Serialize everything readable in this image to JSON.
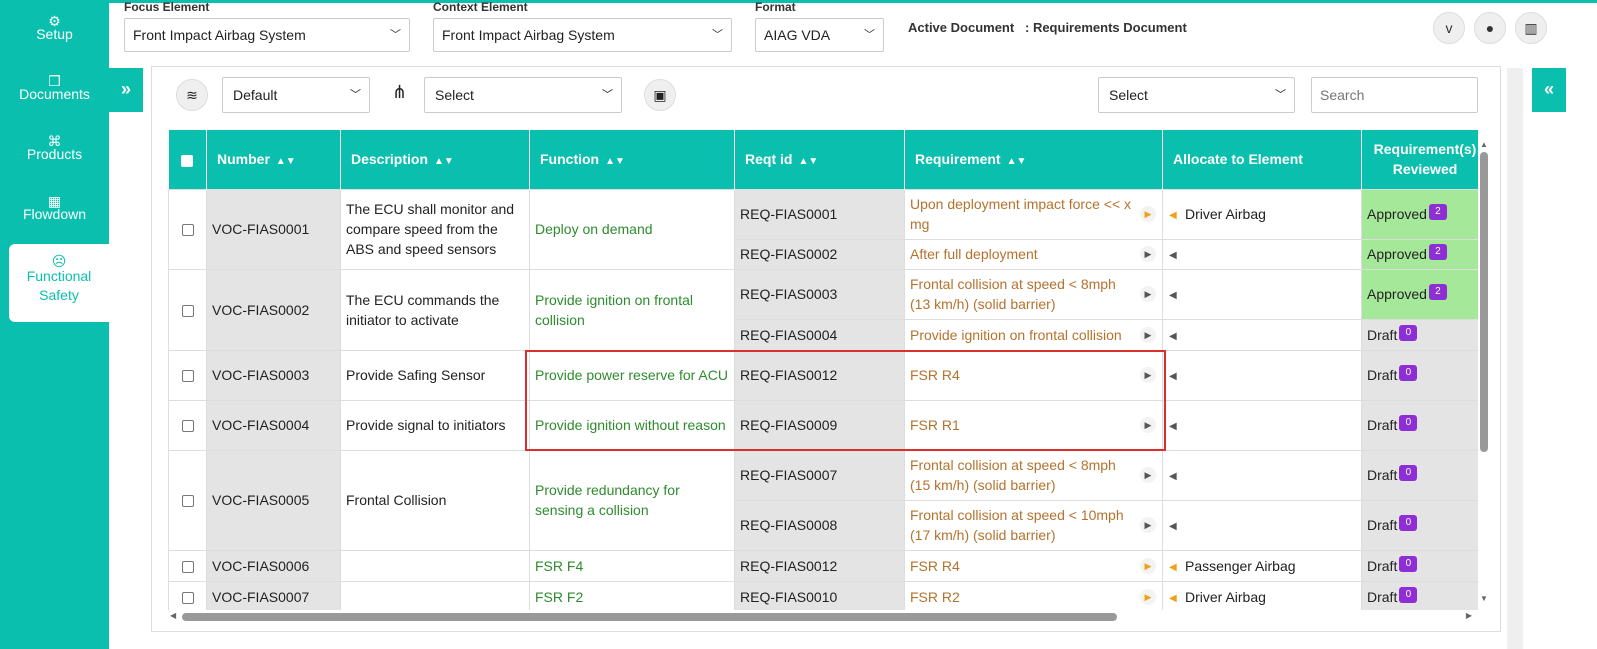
{
  "sidebar": {
    "items": [
      {
        "label": "Setup",
        "icon": "gear-icon",
        "glyph": "⚙"
      },
      {
        "label": "Documents",
        "icon": "documents-icon",
        "glyph": "❐"
      },
      {
        "label": "Products",
        "icon": "products-icon",
        "glyph": "⌘"
      },
      {
        "label": "Flowdown",
        "icon": "flowdown-icon",
        "glyph": "▦"
      },
      {
        "label": "Functional",
        "label2": "Safety",
        "icon": "safety-icon",
        "glyph": "☹"
      }
    ]
  },
  "header": {
    "focus_label": "Focus Element",
    "focus_value": "Front Impact Airbag System",
    "context_label": "Context Element",
    "context_value": "Front Impact Airbag System",
    "format_label": "Format",
    "format_value": "AIAG VDA",
    "active_doc_label": "Active Document",
    "active_doc_value": ": Requirements Document"
  },
  "header_icons": [
    {
      "name": "vimeo-icon",
      "glyph": "v"
    },
    {
      "name": "drop-icon",
      "glyph": "●"
    },
    {
      "name": "chart-icon",
      "glyph": "▥"
    }
  ],
  "toolbar": {
    "view_value": "Default",
    "flow_value": "Select",
    "right_select_value": "Select",
    "search_placeholder": "Search"
  },
  "table": {
    "headers": [
      "Number",
      "Description",
      "Function",
      "Reqt id",
      "Requirement",
      "Allocate to Element",
      "Requirement(s)",
      "Reviewed"
    ],
    "rows": [
      {
        "number": "VOC-FIAS0001",
        "description": "The ECU shall monitor and compare speed from the ABS and speed sensors",
        "function": "Deploy on demand",
        "subs": [
          {
            "reqid": "REQ-FIAS0001",
            "req": "Upon deployment impact force << x mg",
            "alloc": "Driver Airbag",
            "status": "Approved",
            "count": "2",
            "active": true
          },
          {
            "reqid": "REQ-FIAS0002",
            "req": "After full deployment",
            "alloc": "",
            "status": "Approved",
            "count": "2",
            "active": false
          }
        ]
      },
      {
        "number": "VOC-FIAS0002",
        "description": "The ECU commands the initiator to activate",
        "function": "Provide ignition on frontal collision",
        "subs": [
          {
            "reqid": "REQ-FIAS0003",
            "req": "Frontal collision at speed < 8mph (13 km/h) (solid barrier)",
            "alloc": "",
            "status": "Approved",
            "count": "2",
            "active": false
          },
          {
            "reqid": "REQ-FIAS0004",
            "req": "Provide ignition on frontal collision",
            "alloc": "",
            "status": "Draft",
            "count": "0",
            "active": false
          }
        ]
      },
      {
        "number": "VOC-FIAS0003",
        "description": "Provide Safing Sensor",
        "function": "Provide power reserve for ACU",
        "subs": [
          {
            "reqid": "REQ-FIAS0012",
            "req": "FSR R4",
            "alloc": "",
            "status": "Draft",
            "count": "0",
            "active": false
          }
        ]
      },
      {
        "number": "VOC-FIAS0004",
        "description": "Provide signal to initiators",
        "function": "Provide ignition without reason",
        "subs": [
          {
            "reqid": "REQ-FIAS0009",
            "req": "FSR R1",
            "alloc": "",
            "status": "Draft",
            "count": "0",
            "active": false
          }
        ]
      },
      {
        "number": "VOC-FIAS0005",
        "description": "Frontal Collision",
        "function": "Provide redundancy for sensing a collision",
        "subs": [
          {
            "reqid": "REQ-FIAS0007",
            "req": "Frontal collision at speed < 8mph (15 km/h) (solid barrier)",
            "alloc": "",
            "status": "Draft",
            "count": "0",
            "active": false
          },
          {
            "reqid": "REQ-FIAS0008",
            "req": "Frontal collision at speed < 10mph (17 km/h) (solid barrier)",
            "alloc": "",
            "status": "Draft",
            "count": "0",
            "active": false
          }
        ]
      },
      {
        "number": "VOC-FIAS0006",
        "description": "",
        "function": "FSR F4",
        "subs": [
          {
            "reqid": "REQ-FIAS0012",
            "req": "FSR R4",
            "alloc": "Passenger Airbag",
            "status": "Draft",
            "count": "0",
            "active": true
          }
        ]
      },
      {
        "number": "VOC-FIAS0007",
        "description": "",
        "function": "FSR F2",
        "subs": [
          {
            "reqid": "REQ-FIAS0010",
            "req": "FSR R2",
            "alloc": "Driver Airbag",
            "status": "Draft",
            "count": "0",
            "active": true
          }
        ]
      }
    ]
  }
}
